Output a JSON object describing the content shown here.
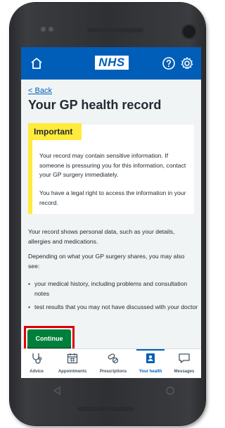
{
  "header": {
    "logo_text": "NHS",
    "home_icon": "home-icon",
    "help_icon": "help-icon",
    "settings_icon": "gear-icon",
    "background_color": "#005eb8"
  },
  "page": {
    "back_label": "Back",
    "title": "Your GP health record"
  },
  "callout": {
    "label": "Important",
    "paragraph_1": "Your record may contain sensitive information. If someone is pressuring you for this information, contact your GP surgery immediately.",
    "paragraph_2": "You have a legal right to access the information in your record.",
    "accent_color": "#ffeb3b"
  },
  "body": {
    "paragraph_1": "Your record shows personal data, such as your details, allergies and medications.",
    "paragraph_2": "Depending on what your GP surgery shares, you may also see:",
    "bullets": [
      "your medical history, including problems and consultation notes",
      "test results that you may not have discussed with your doctor"
    ]
  },
  "actions": {
    "continue_label": "Continue",
    "continue_color": "#007f3b",
    "highlight_color": "#e00000"
  },
  "tabbar": {
    "items": [
      {
        "label": "Advice",
        "icon": "stethoscope-icon",
        "active": false
      },
      {
        "label": "Appointments",
        "icon": "calendar-icon",
        "active": false
      },
      {
        "label": "Prescriptions",
        "icon": "pills-icon",
        "active": false
      },
      {
        "label": "Your health",
        "icon": "health-record-icon",
        "active": true
      },
      {
        "label": "Messages",
        "icon": "message-icon",
        "active": false
      }
    ]
  },
  "device": {
    "nav_back_icon": "back-triangle-icon",
    "nav_home_icon": "home-circle-icon"
  }
}
